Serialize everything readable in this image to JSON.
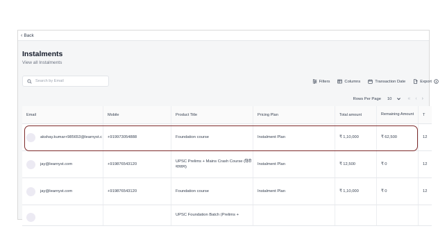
{
  "nav": {
    "back_label": "Back"
  },
  "page": {
    "title": "Instalments",
    "subtitle": "View all Instalments"
  },
  "search": {
    "placeholder": "Search by Email",
    "value": ""
  },
  "toolbar": {
    "filters": "Filters",
    "columns": "Columns",
    "transaction_date": "Transaction Date",
    "export": "Export"
  },
  "pagination": {
    "rows_per_page_label": "Rows Per Page",
    "rows_per_page_value": "10"
  },
  "table": {
    "headers": [
      "Email",
      "Mobile",
      "Product Title",
      "Pricing Plan",
      "Total amount",
      "Remaining Amount",
      "T"
    ],
    "rows": [
      {
        "email": "akshay.kumar+985653@learnyst.c",
        "mobile": "+919973054888",
        "product": "Foundation course",
        "plan": "Instalment Plan",
        "total": "₹ 1,10,000",
        "remaining": "₹ 62,500",
        "extra": "12"
      },
      {
        "email": "jay@learnyst.com",
        "mobile": "+919876543120",
        "product": "UPSC Prelims + Mains Crash Course (हिंदी माध्यम)",
        "plan": "Instalment Plan",
        "total": "₹ 12,500",
        "remaining": "₹ 0",
        "extra": "12"
      },
      {
        "email": "jay@learnyst.com",
        "mobile": "+919876543120",
        "product": "Foundation course",
        "plan": "Instalment Plan",
        "total": "₹ 1,10,000",
        "remaining": "₹ 0",
        "extra": "12"
      },
      {
        "email": "",
        "mobile": "",
        "product": "UPSC Foundation Batch (Prelims +",
        "plan": "",
        "total": "",
        "remaining": "",
        "extra": ""
      }
    ]
  },
  "colors": {
    "highlight": "#7d2a2a",
    "avatar": "#eceaf3"
  },
  "icons": [
    "chevron-left-icon",
    "search-icon",
    "filter-icon",
    "columns-icon",
    "calendar-icon",
    "export-icon",
    "info-icon",
    "chevron-down-icon",
    "first-page-icon",
    "prev-page-icon",
    "next-page-icon"
  ]
}
